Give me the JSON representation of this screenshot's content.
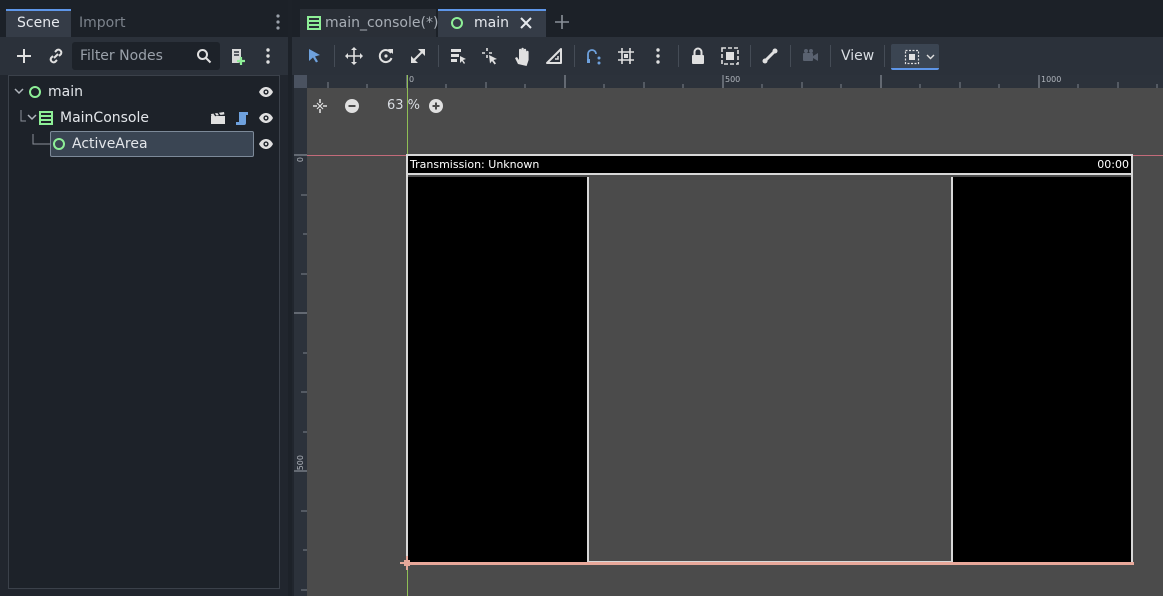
{
  "dock": {
    "tabs": {
      "scene": "Scene",
      "import": "Import"
    },
    "filter": {
      "placeholder": "Filter Nodes"
    },
    "tree": [
      {
        "label": "main",
        "icon": "node-circle-icon"
      },
      {
        "label": "MainConsole",
        "icon": "container-icon"
      },
      {
        "label": "ActiveArea",
        "icon": "node-circle-icon",
        "selected": true
      }
    ]
  },
  "editor": {
    "tabs": [
      {
        "label": "main_console(*)",
        "icon": "container-icon"
      },
      {
        "label": "main",
        "icon": "node-circle-icon",
        "active": true
      }
    ],
    "toolbar": {
      "view_label": "View"
    },
    "zoom": {
      "level": "63 %"
    },
    "rulers": {
      "top": [
        "0",
        "500",
        "1000"
      ],
      "left": [
        "0",
        "500"
      ]
    },
    "console": {
      "title": "Transmission: Unknown",
      "time": "00:00"
    }
  },
  "colors": {
    "accent": "#5e96e8",
    "node_green": "#8eef97",
    "script_blue": "#6ea1dd",
    "canvas": "#4b4b4b"
  }
}
